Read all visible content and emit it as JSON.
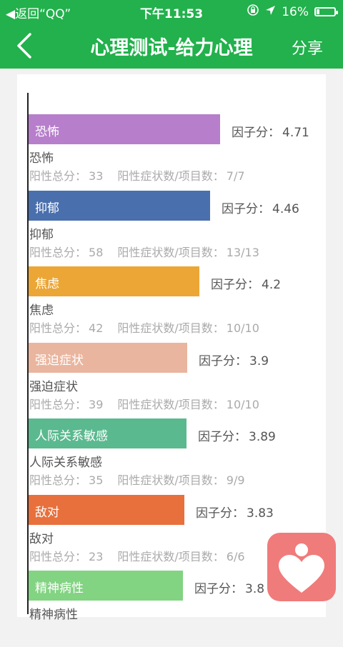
{
  "status_bar": {
    "back_text": "◀返回“QQ”",
    "time": "下午11:53",
    "battery": "16%",
    "battery_level": 0.16
  },
  "nav": {
    "title": "心理测试-给力心理",
    "share": "分享"
  },
  "factor_label": "因子分：",
  "total_label": "阳性总分：",
  "count_label": "阳性症状数/项目数：",
  "chart_data": {
    "type": "bar",
    "orientation": "horizontal",
    "categories": [
      "恐怖",
      "抑郁",
      "焦虑",
      "强迫症状",
      "人际关系敏感",
      "敌对",
      "精神病性"
    ],
    "values": [
      4.71,
      4.46,
      4.2,
      3.9,
      3.89,
      3.83,
      3.8
    ],
    "colors": [
      "#b77ecb",
      "#4a6fad",
      "#eba636",
      "#eab59e",
      "#5bb98f",
      "#e8703c",
      "#82d382"
    ]
  },
  "items": [
    {
      "name": "恐怖",
      "factor": "4.71",
      "total": "33",
      "count": "7/7"
    },
    {
      "name": "抑郁",
      "factor": "4.46",
      "total": "58",
      "count": "13/13"
    },
    {
      "name": "焦虑",
      "factor": "4.2",
      "total": "42",
      "count": "10/10"
    },
    {
      "name": "强迫症状",
      "factor": "3.9",
      "total": "39",
      "count": "10/10"
    },
    {
      "name": "人际关系敏感",
      "factor": "3.89",
      "total": "35",
      "count": "9/9"
    },
    {
      "name": "敌对",
      "factor": "3.83",
      "total": "23",
      "count": "6/6"
    },
    {
      "name": "精神病性",
      "factor": "3.8",
      "total": "",
      "count": ""
    }
  ]
}
